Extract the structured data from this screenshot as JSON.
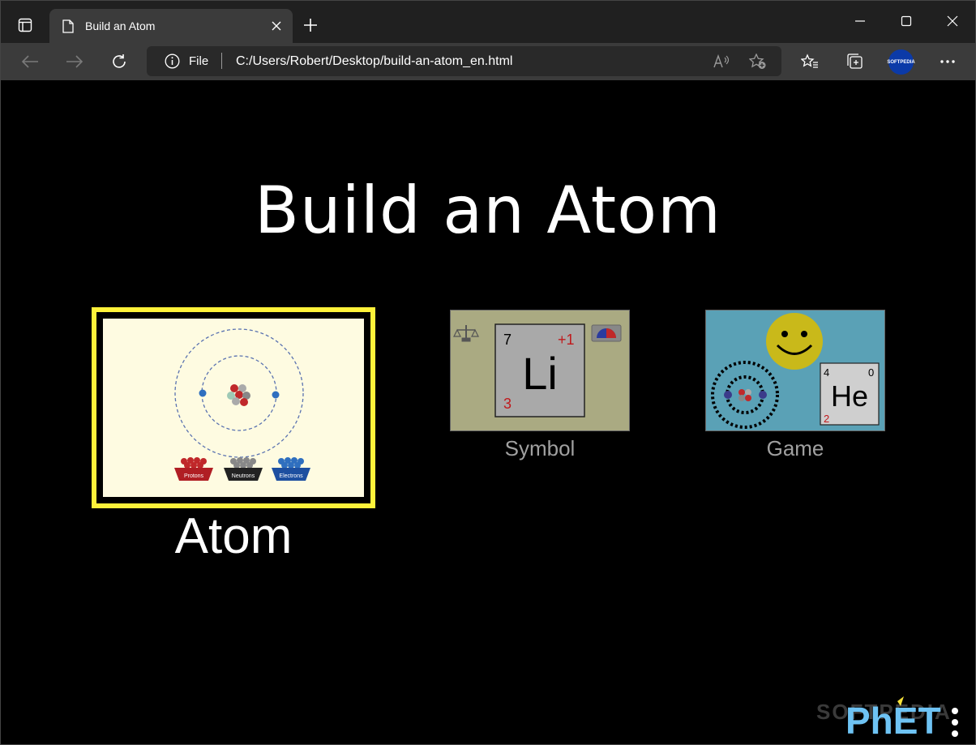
{
  "browser": {
    "tab_title": "Build an Atom",
    "scheme_label": "File",
    "url": "C:/Users/Robert/Desktop/build-an-atom_en.html",
    "profile_label": "SOFTPEDIA"
  },
  "sim": {
    "title": "Build an Atom",
    "screens": [
      {
        "label": "Atom",
        "selected": true
      },
      {
        "label": "Symbol",
        "selected": false
      },
      {
        "label": "Game",
        "selected": false
      }
    ],
    "atom_thumb": {
      "bucket_labels": [
        "Protons",
        "Neutrons",
        "Electrons"
      ]
    },
    "symbol_thumb": {
      "mass_number": "7",
      "charge": "+1",
      "element": "Li",
      "atomic_number": "3"
    },
    "game_thumb": {
      "mass_number": "4",
      "charge": "0",
      "element": "He",
      "atomic_number": "2"
    },
    "logo_text": "PhET",
    "watermark": "SOFTPEDIA"
  },
  "colors": {
    "selected_border": "#fff23a",
    "proton": "#c0282a",
    "neutron": "#888888",
    "electron": "#2f6fbf",
    "phet_blue": "#6ec3f4",
    "phet_yellow": "#f6e13a"
  }
}
